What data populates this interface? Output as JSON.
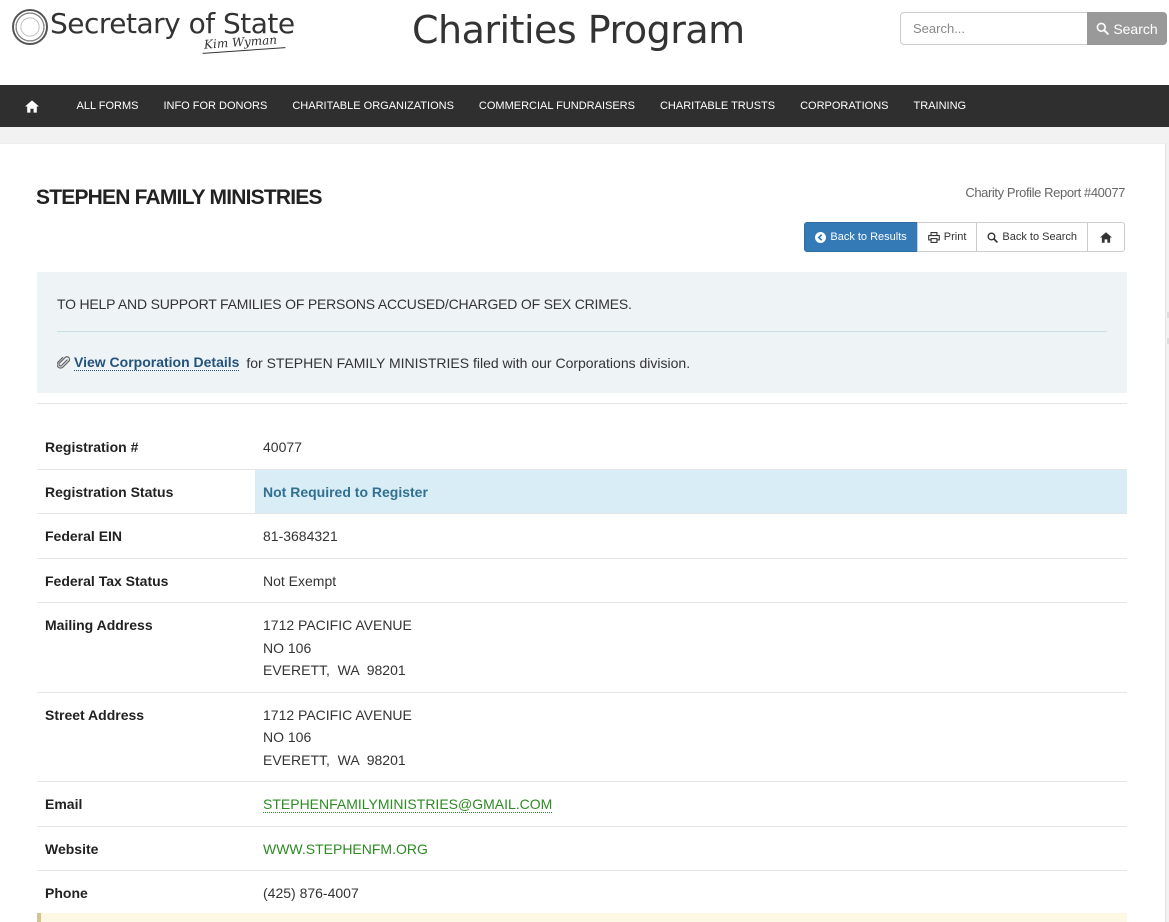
{
  "header": {
    "logo_text": "Secretary of State",
    "signature": "Kim Wyman",
    "site_title": "Charities Program",
    "search": {
      "placeholder": "Search...",
      "button_label": "Search"
    }
  },
  "nav": {
    "items": [
      "ALL FORMS",
      "INFO FOR DONORS",
      "CHARITABLE ORGANIZATIONS",
      "COMMERCIAL FUNDRAISERS",
      "CHARITABLE TRUSTS",
      "CORPORATIONS",
      "TRAINING"
    ]
  },
  "profile": {
    "org_name": "STEPHEN FAMILY MINISTRIES",
    "report_id": "Charity Profile Report #40077",
    "buttons": {
      "back_results": "Back to Results",
      "print": "Print",
      "back_search": "Back to Search"
    },
    "mission": "TO HELP AND SUPPORT FAMILIES OF PERSONS ACCUSED/CHARGED OF SEX CRIMES.",
    "corp_link": "View Corporation Details",
    "corp_text": " for STEPHEN FAMILY MINISTRIES filed with our Corporations division."
  },
  "details": {
    "registration_num": {
      "label": "Registration #",
      "value": "40077"
    },
    "registration_status": {
      "label": "Registration Status",
      "value": "Not Required to Register"
    },
    "federal_ein": {
      "label": "Federal EIN",
      "value": "81-3684321"
    },
    "federal_tax_status": {
      "label": "Federal Tax Status",
      "value": "Not Exempt"
    },
    "mailing_address": {
      "label": "Mailing Address",
      "line1": "1712 PACIFIC AVENUE",
      "line2": "NO 106",
      "line3": "EVERETT,  WA  98201"
    },
    "street_address": {
      "label": "Street Address",
      "line1": "1712 PACIFIC AVENUE",
      "line2": "NO 106",
      "line3": "EVERETT,  WA  98201"
    },
    "email": {
      "label": "Email",
      "value": "STEPHENFAMILYMINISTRIES@GMAIL.COM"
    },
    "website": {
      "label": "Website",
      "value": "WWW.STEPHENFM.ORG"
    },
    "phone": {
      "label": "Phone",
      "value": "(425) 876-4007"
    }
  },
  "colors": {
    "nav_bg": "#2f2f2f",
    "primary": "#337ab7",
    "status_bg": "#d9edf7",
    "link_green": "#2d8b23",
    "info_bg": "#eef3f6"
  }
}
